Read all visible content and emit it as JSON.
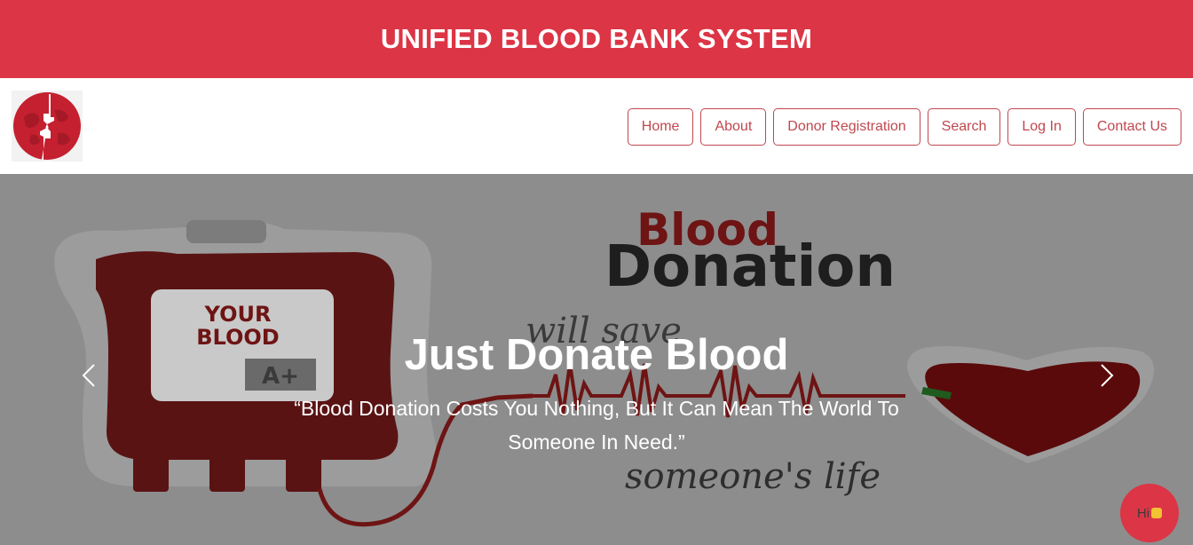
{
  "header": {
    "title": "UNIFIED BLOOD BANK SYSTEM"
  },
  "nav": {
    "logo_icon": "blood-drop-hands-logo",
    "items": [
      {
        "label": "Home"
      },
      {
        "label": "About"
      },
      {
        "label": "Donor Registration"
      },
      {
        "label": "Search"
      },
      {
        "label": "Log In"
      },
      {
        "label": "Contact Us"
      }
    ]
  },
  "hero": {
    "title": "Just Donate Blood",
    "quote": "“Blood Donation Costs You Nothing, But It Can Mean The World To Someone In Need.”",
    "image_text": {
      "bag_line1": "YOUR",
      "bag_line2": "BLOOD",
      "blood_type": "A+",
      "headline1": "Blood",
      "headline2": "Donation",
      "script1": "will save",
      "script2": "someone's life"
    },
    "prev_icon": "chevron-left-icon",
    "next_icon": "chevron-right-icon"
  },
  "chat": {
    "label": "Hi",
    "icon": "waving-hand-icon"
  },
  "colors": {
    "brand": "#dc3545",
    "nav_border": "#c0474f",
    "overlay": "#8d8d8d"
  }
}
